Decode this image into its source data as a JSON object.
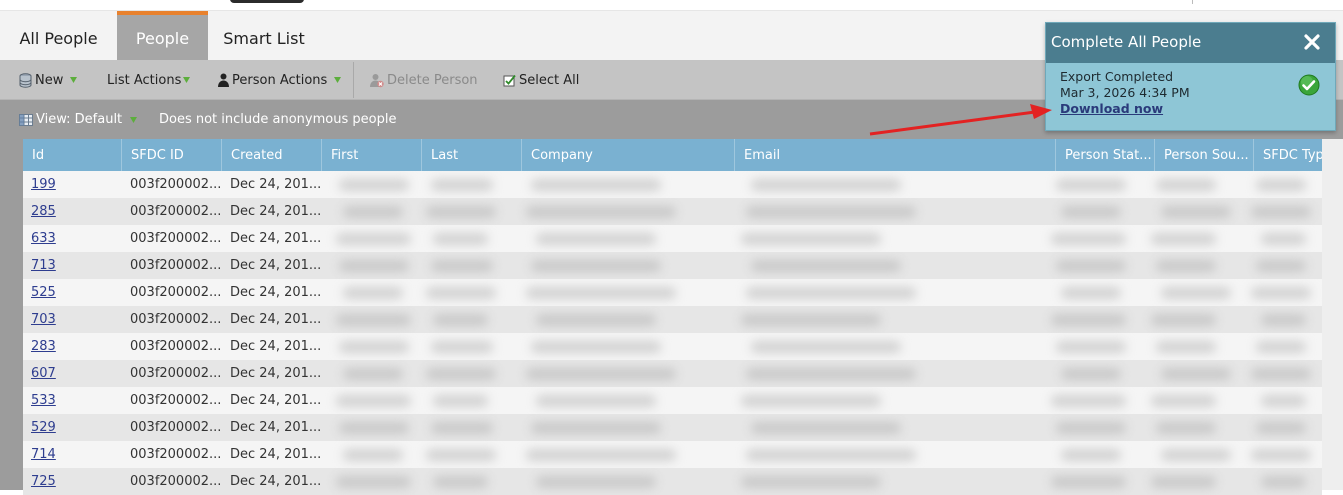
{
  "tabs": [
    {
      "label": "All People"
    },
    {
      "label": "People"
    },
    {
      "label": "Smart List"
    }
  ],
  "toolbar": {
    "new_label": "New",
    "list_actions_label": "List Actions",
    "person_actions_label": "Person Actions",
    "delete_person_label": "Delete Person",
    "select_all_label": "Select All"
  },
  "viewbar": {
    "view_label": "View: Default",
    "note": "Does not include anonymous people"
  },
  "table": {
    "columns": [
      "Id",
      "SFDC ID",
      "Created",
      "First",
      "Last",
      "Company",
      "Email",
      "Person Stat...",
      "Person Sou...",
      "SFDC Type"
    ],
    "rows": [
      {
        "id": "199",
        "sfdc_id": "003f200002...",
        "created": "Dec 24, 201..."
      },
      {
        "id": "285",
        "sfdc_id": "003f200002...",
        "created": "Dec 24, 201..."
      },
      {
        "id": "633",
        "sfdc_id": "003f200002...",
        "created": "Dec 24, 201..."
      },
      {
        "id": "713",
        "sfdc_id": "003f200002...",
        "created": "Dec 24, 201..."
      },
      {
        "id": "525",
        "sfdc_id": "003f200002...",
        "created": "Dec 24, 201..."
      },
      {
        "id": "703",
        "sfdc_id": "003f200002...",
        "created": "Dec 24, 201..."
      },
      {
        "id": "283",
        "sfdc_id": "003f200002...",
        "created": "Dec 24, 201..."
      },
      {
        "id": "607",
        "sfdc_id": "003f200002...",
        "created": "Dec 24, 201..."
      },
      {
        "id": "533",
        "sfdc_id": "003f200002...",
        "created": "Dec 24, 201..."
      },
      {
        "id": "529",
        "sfdc_id": "003f200002...",
        "created": "Dec 24, 201..."
      },
      {
        "id": "714",
        "sfdc_id": "003f200002...",
        "created": "Dec 24, 201..."
      },
      {
        "id": "725",
        "sfdc_id": "003f200002...",
        "created": "Dec 24, 201..."
      }
    ]
  },
  "toast": {
    "title": "Complete All People",
    "status": "Export Completed",
    "timestamp": "Mar 3, 2026 4:34 PM",
    "link": "Download now"
  },
  "icons": {
    "new": "database-icon",
    "person_actions": "person-icon",
    "delete_person": "delete-person-icon",
    "select_all": "checkbox-icon",
    "view": "grid-view-icon",
    "dropdown": "green-triangle-icon",
    "toast_close": "close-icon",
    "toast_check": "check-circle-icon"
  },
  "colors": {
    "tab_accent": "#e8812d",
    "header_bg": "#7ab1d1",
    "toast_header": "#4b7d8f",
    "toast_body": "#8ec6d6",
    "annotation_arrow": "#e32222",
    "link": "#2e3d8f"
  }
}
